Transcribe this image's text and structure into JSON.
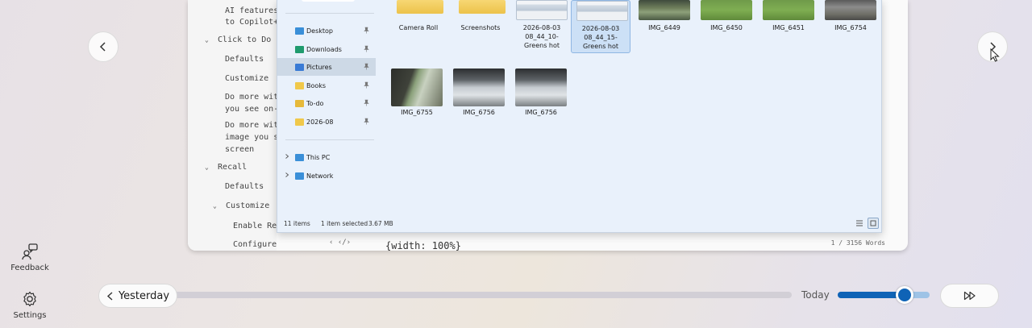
{
  "navigation": {
    "previous_icon": "chevron-left-icon",
    "next_icon": "chevron-right-icon"
  },
  "document": {
    "outline": [
      {
        "text": "AI features",
        "indent": 2,
        "toggle": ""
      },
      {
        "text": "to Copilot+",
        "indent": 2,
        "toggle": ""
      },
      {
        "text": "Click to Do",
        "indent": 1,
        "toggle": "⌄"
      },
      {
        "text": "Defaults",
        "indent": 2,
        "toggle": ""
      },
      {
        "text": "Customize",
        "indent": 2,
        "toggle": ""
      },
      {
        "text": "Do more with",
        "indent": 2,
        "toggle": ""
      },
      {
        "text": "you see on-s",
        "indent": 2,
        "toggle": ""
      },
      {
        "text": "Do more with",
        "indent": 2,
        "toggle": ""
      },
      {
        "text": "image you se",
        "indent": 2,
        "toggle": ""
      },
      {
        "text": "screen",
        "indent": 2,
        "toggle": ""
      },
      {
        "text": "Recall",
        "indent": 1,
        "toggle": "⌄"
      },
      {
        "text": "Defaults",
        "indent": 2,
        "toggle": ""
      },
      {
        "text": "Customize",
        "indent": 3,
        "toggle": "⌄"
      },
      {
        "text": "Enable Rec",
        "indent": 4,
        "toggle": ""
      },
      {
        "text": "Configure Recall",
        "indent": 4,
        "toggle": ""
      }
    ],
    "bottom_icons": "‹  ‹/›",
    "code_text": "{width: 100%}",
    "word_count": "1 / 3156 Words"
  },
  "explorer": {
    "nav_items": [
      {
        "label": "Desktop",
        "color": "#3a8fd8",
        "pinned": true,
        "selected": false
      },
      {
        "label": "Downloads",
        "color": "#1f9b6e",
        "pinned": true,
        "selected": false
      },
      {
        "label": "Pictures",
        "color": "#3a7bd5",
        "pinned": true,
        "selected": true
      },
      {
        "label": "Books",
        "color": "#f0c84a",
        "pinned": true,
        "selected": false
      },
      {
        "label": "To-do",
        "color": "#e6b93a",
        "pinned": true,
        "selected": false
      },
      {
        "label": "2026-08",
        "color": "#f0c84a",
        "pinned": true,
        "selected": false
      }
    ],
    "nav_locations": [
      {
        "label": "This PC",
        "color": "#3a8fd8"
      },
      {
        "label": "Network",
        "color": "#3a8fd8"
      }
    ],
    "files": [
      {
        "name": "Camera Roll",
        "kind": "folder",
        "selected": false
      },
      {
        "name": "Screenshots",
        "kind": "folder",
        "selected": false
      },
      {
        "name": "2026-08-03 08_44_10-Greens hot",
        "kind": "screenshot",
        "selected": false
      },
      {
        "name": "2026-08-03 08_44_15-Greens hot",
        "kind": "screenshot",
        "selected": true
      },
      {
        "name": "IMG_6449",
        "kind": "photo-garden",
        "selected": false
      },
      {
        "name": "IMG_6450",
        "kind": "photo-grass",
        "selected": false
      },
      {
        "name": "IMG_6451",
        "kind": "photo-grass",
        "selected": false
      },
      {
        "name": "IMG_6754",
        "kind": "photo-bed",
        "selected": false
      },
      {
        "name": "IMG_6755",
        "kind": "photo-window",
        "selected": false
      },
      {
        "name": "IMG_6756",
        "kind": "photo-roof",
        "selected": false
      },
      {
        "name": "IMG_6756",
        "kind": "photo-roof",
        "selected": false
      }
    ],
    "status": {
      "item_count": "11 items",
      "selection": "1 item selected",
      "size": "3.67 MB"
    },
    "views": [
      "details-view-icon",
      "large-icons-view-icon"
    ]
  },
  "rail": {
    "feedback_label": "Feedback",
    "feedback_icon": "feedback-people-icon",
    "settings_label": "Settings",
    "settings_icon": "gear-icon"
  },
  "timeline": {
    "yesterday_label": "Yesterday",
    "today_label": "Today",
    "zoom_level": 0.73,
    "fast_forward_icon": "fast-forward-icon",
    "accent": "#0f63b6"
  }
}
